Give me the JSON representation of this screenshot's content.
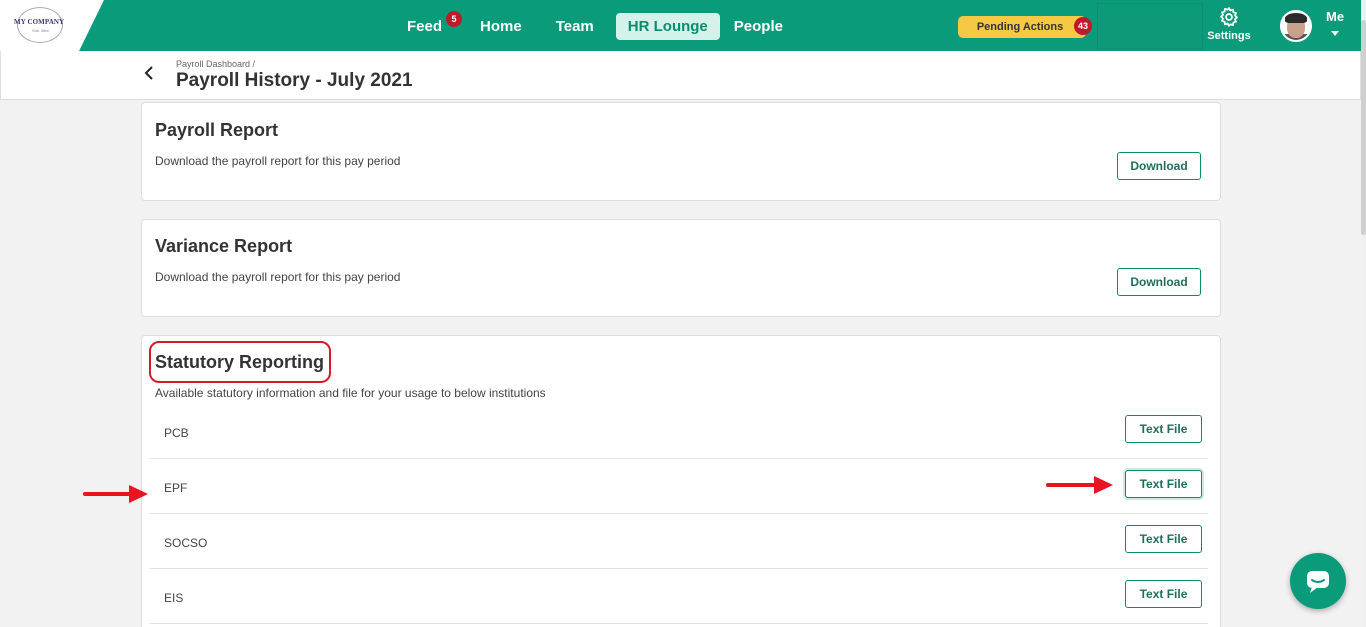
{
  "logo": {
    "text": "MY COMPANY",
    "sub": "Sdn. Bhd."
  },
  "nav": {
    "feed": "Feed",
    "feed_badge": "5",
    "home": "Home",
    "team": "Team",
    "hr_lounge": "HR Lounge",
    "people": "People"
  },
  "pending": {
    "label": "Pending Actions",
    "count": "43"
  },
  "settings": {
    "label": "Settings"
  },
  "user": {
    "label": "Me"
  },
  "breadcrumb": "Payroll Dashboard /",
  "page_title": "Payroll History - July 2021",
  "payroll_report": {
    "title": "Payroll Report",
    "desc": "Download the payroll report for this pay period",
    "button": "Download"
  },
  "variance_report": {
    "title": "Variance Report",
    "desc": "Download the payroll report for this pay period",
    "button": "Download"
  },
  "statutory": {
    "title": "Statutory Reporting",
    "desc": "Available statutory information and file for your usage to below institutions",
    "rows": [
      {
        "label": "PCB",
        "button": "Text File"
      },
      {
        "label": "EPF",
        "button": "Text File"
      },
      {
        "label": "SOCSO",
        "button": "Text File"
      },
      {
        "label": "EIS",
        "button": "Text File"
      }
    ]
  },
  "colors": {
    "brand": "#0a9b7a",
    "badge": "#c2182b",
    "pending": "#f6c945",
    "annotation": "#e8141f"
  }
}
